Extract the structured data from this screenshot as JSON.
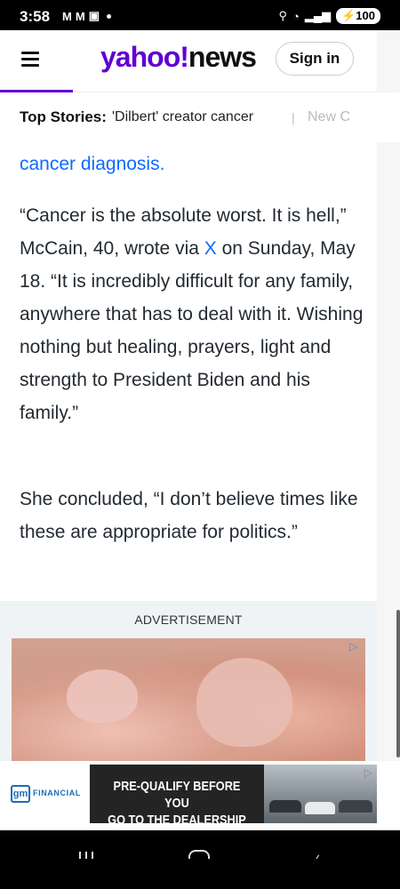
{
  "status_bar": {
    "time": "3:58",
    "notification_icons": [
      "M",
      "M"
    ],
    "battery": "100"
  },
  "header": {
    "logo_yahoo": "yahoo!",
    "logo_news": "news",
    "sign_in_label": "Sign in",
    "accent_color": "#6001d2"
  },
  "top_stories": {
    "label": "Top Stories:",
    "items": [
      "'Dilbert' creator cancer",
      "New C"
    ]
  },
  "article": {
    "para0_link": "cancer diagnosis.",
    "para1_a": "“Cancer is the absolute worst. It is hell,” McCain, 40, wrote via ",
    "para1_link": "X",
    "para1_b": " on Sunday, May 18. “It is incredibly difficult for any family, anywhere that has to deal with it. Wishing nothing but healing, prayers, light and strength to President Biden and his family.”",
    "para2": "She concluded, “I don’t believe times like these are appropriate for politics.”"
  },
  "ad": {
    "label": "ADVERTISEMENT"
  },
  "banner": {
    "brand_short": "gm",
    "brand_text": "FINANCIAL",
    "cta_line1": "PRE-QUALIFY BEFORE YOU",
    "cta_line2": "GO TO THE DEALERSHIP"
  },
  "icons": {
    "menu": "hamburger-menu-icon",
    "ad_choices": "ad-choices-icon",
    "nav_back": "back-icon",
    "nav_home": "home-icon",
    "nav_recent": "recent-apps-icon"
  }
}
